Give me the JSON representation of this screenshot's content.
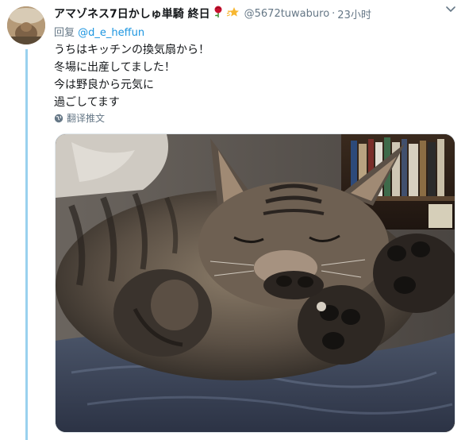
{
  "tweet": {
    "display_name": "アマゾネス7日かしゅ単騎 終日",
    "emoji_1": "rose-emoji",
    "emoji_2": "sparkle-star-emoji",
    "handle": "@5672tuwaburo",
    "separator": "·",
    "time": "23小时",
    "reply_prefix": "回复",
    "reply_to": "@d_e_heffun",
    "text_lines": [
      "うちはキッチンの換気扇から！",
      "冬場に出産してました！",
      "今は野良から元気に",
      "過ごしてます"
    ],
    "translate_label": "翻译推文",
    "media_alt": "sleeping-tabby-cat-photo"
  },
  "colors": {
    "link": "#1b95e0",
    "secondary_text": "#657786",
    "primary_text": "#14171a",
    "thread_line": "#9ad1ee"
  }
}
